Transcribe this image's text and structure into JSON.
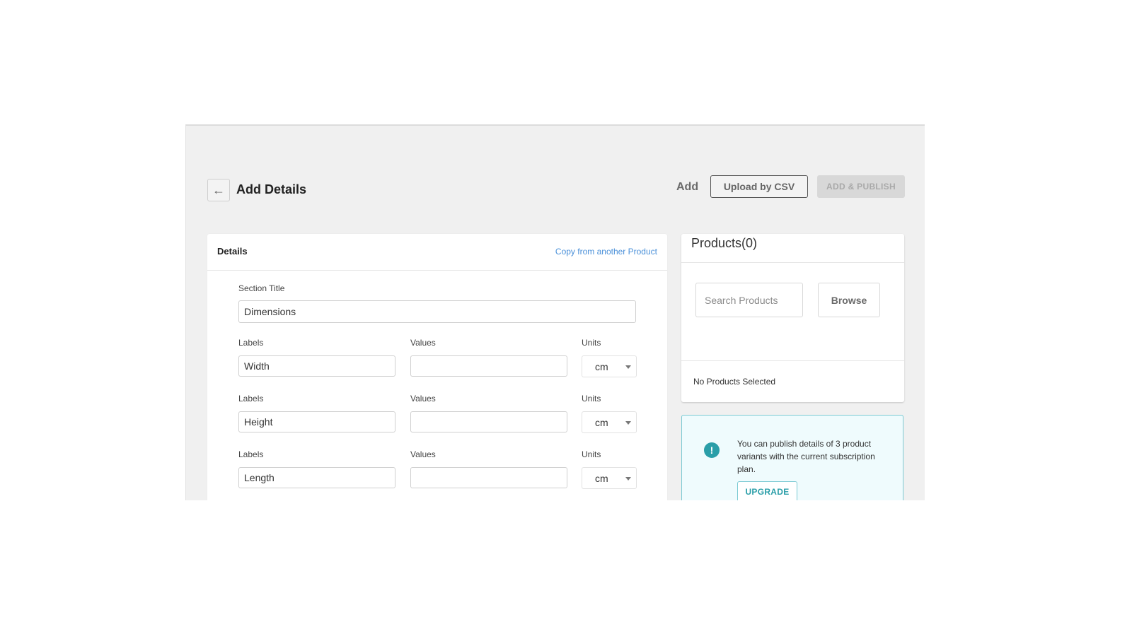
{
  "header": {
    "title": "Add Details",
    "add_label": "Add",
    "upload_csv_label": "Upload by CSV",
    "add_publish_label": "ADD & PUBLISH"
  },
  "details": {
    "title": "Details",
    "copy_link": "Copy from another Product",
    "section_title_label": "Section Title",
    "section_title_value": "Dimensions",
    "rows": [
      {
        "label_caption": "Labels",
        "label_value": "Width",
        "values_caption": "Values",
        "value": "",
        "units_caption": "Units",
        "unit": "cm"
      },
      {
        "label_caption": "Labels",
        "label_value": "Height",
        "values_caption": "Values",
        "value": "",
        "units_caption": "Units",
        "unit": "cm"
      },
      {
        "label_caption": "Labels",
        "label_value": "Length",
        "values_caption": "Values",
        "value": "",
        "units_caption": "Units",
        "unit": "cm"
      }
    ]
  },
  "products": {
    "title": "Products(0)",
    "search_placeholder": "Search Products",
    "browse_label": "Browse",
    "empty_text": "No Products Selected"
  },
  "info": {
    "message": "You can publish details of 3 product variants with the current subscription plan.",
    "upgrade_label": "UPGRADE",
    "accent_color": "#2a9ea8"
  }
}
